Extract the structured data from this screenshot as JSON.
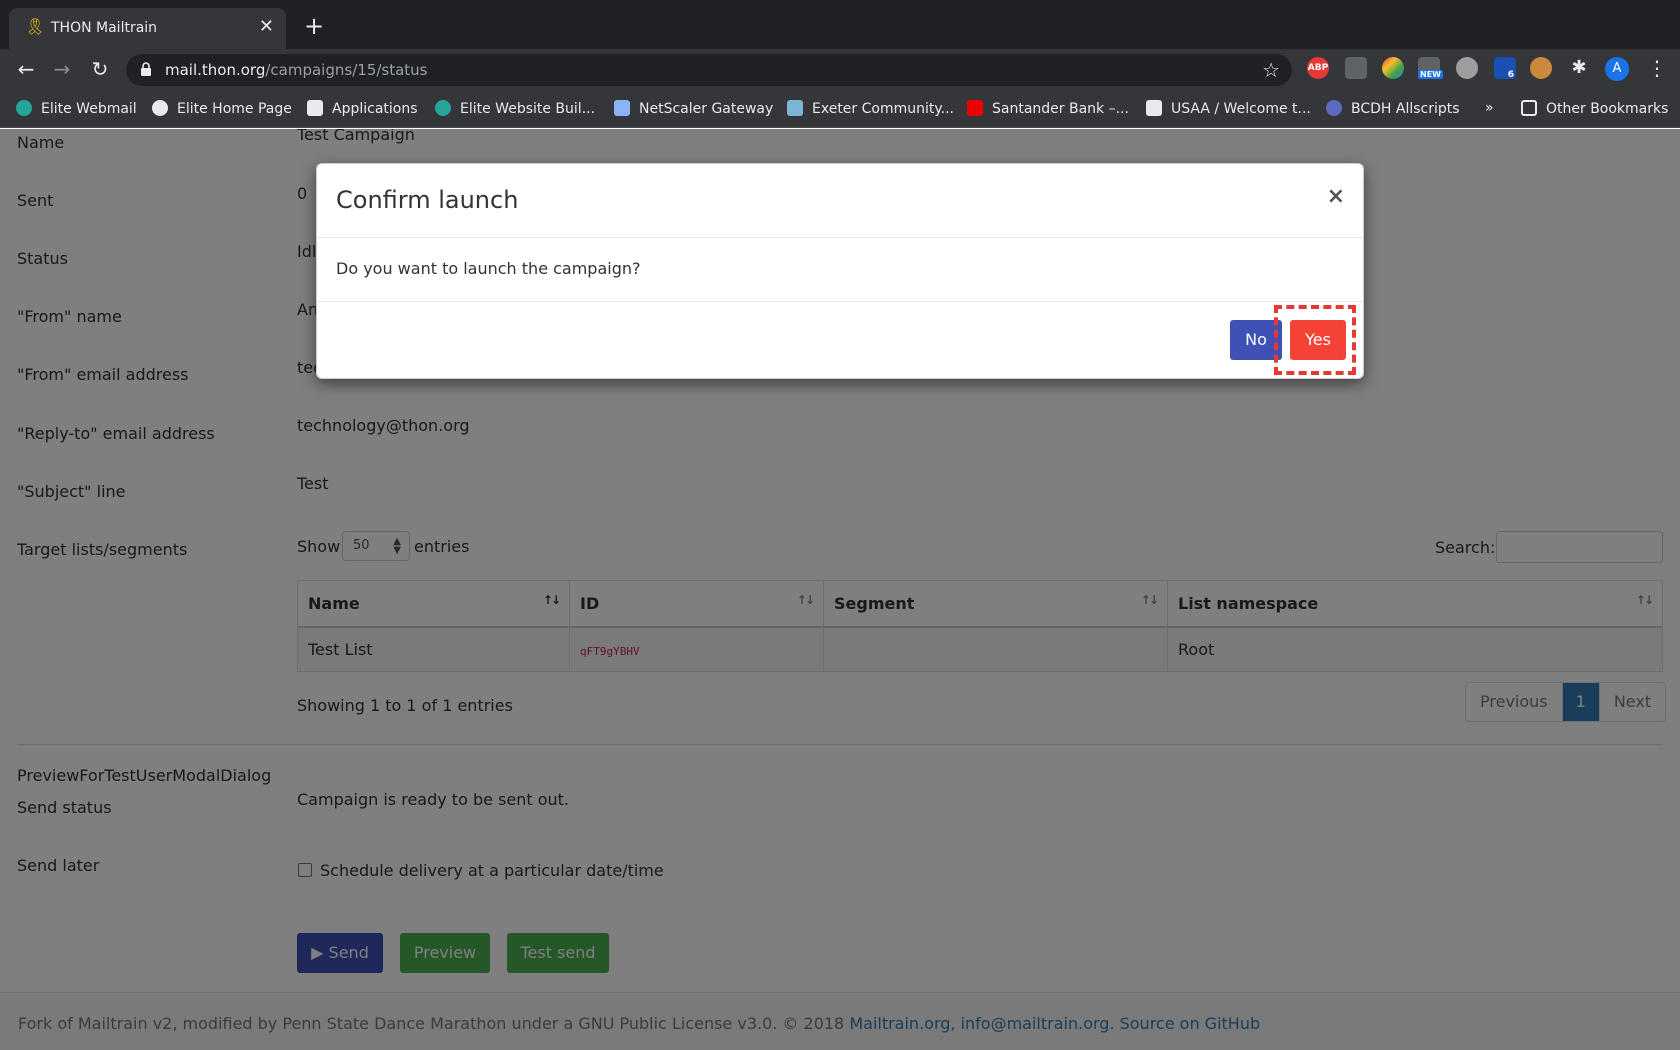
{
  "browser": {
    "tab_title": "THON Mailtrain",
    "url_host": "mail.thon.org",
    "url_path": "/campaigns/15/status",
    "ext_abp": "ABP",
    "ext_new": "NEW",
    "ext_badge": "6",
    "profile_initial": "A",
    "bookmarks": [
      "Elite Webmail",
      "Elite Home Page",
      "Applications",
      "Elite Website Buil...",
      "NetScaler Gateway",
      "Exeter Community...",
      "Santander Bank –...",
      "USAA / Welcome t...",
      "BCDH Allscripts"
    ],
    "bookmarks_overflow": "»",
    "other_bookmarks": "Other Bookmarks"
  },
  "fields": {
    "name_label": "Name",
    "name_value": "Test Campaign",
    "sent_label": "Sent",
    "sent_value": "0",
    "status_label": "Status",
    "status_value": "Idl",
    "from_name_label": "\"From\" name",
    "from_name_value": "An",
    "from_email_label": "\"From\" email address",
    "from_email_value": "tec",
    "reply_to_label": "\"Reply-to\" email address",
    "reply_to_value": "technology@thon.org",
    "subject_label": "\"Subject\" line",
    "subject_value": "Test",
    "target_label": "Target lists/segments"
  },
  "table": {
    "show_label": "Show",
    "page_size": "50",
    "entries_label": "entries",
    "search_label": "Search:",
    "columns": [
      "Name",
      "ID",
      "Segment",
      "List namespace"
    ],
    "rows": [
      {
        "name": "Test List",
        "id": "qFT9gYBHV",
        "segment": "",
        "namespace": "Root"
      }
    ],
    "info": "Showing 1 to 1 of 1 entries",
    "pager": {
      "previous": "Previous",
      "current": "1",
      "next": "Next"
    }
  },
  "send": {
    "preview_dialog_label": "PreviewForTestUserModalDialog",
    "send_status_label": "Send status",
    "send_status_value": "Campaign is ready to be sent out.",
    "send_later_label": "Send later",
    "schedule_label": "Schedule delivery at a particular date/time",
    "send_button": "Send",
    "preview_button": "Preview",
    "test_send_button": "Test send"
  },
  "footer": {
    "text": "Fork of Mailtrain v2, modified by Penn State Dance Marathon under a GNU Public License v3.0. © 2018 ",
    "link1": "Mailtrain.org",
    "sep1": ", ",
    "link2": "info@mailtrain.org",
    "sep2": ". ",
    "link3": "Source on GitHub"
  },
  "modal": {
    "title": "Confirm launch",
    "close": "×",
    "message": "Do you want to launch the campaign?",
    "no_label": "No",
    "yes_label": "Yes"
  },
  "colors": {
    "primary": "#3f51b5",
    "danger": "#f44336",
    "success": "#4caf50",
    "highlight": "#e53935"
  }
}
